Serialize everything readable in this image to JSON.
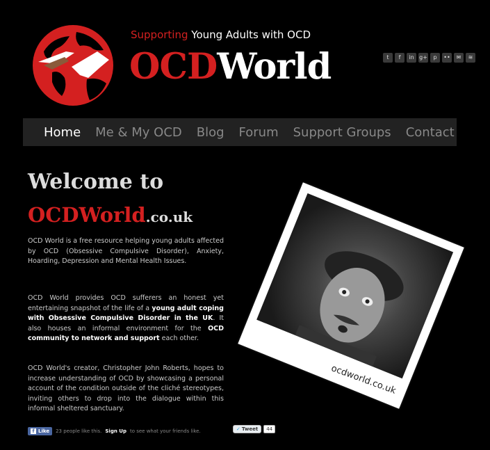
{
  "header": {
    "tagline_highlight": "Supporting",
    "tagline_rest": " Young Adults with OCD",
    "brand_red": "OCD",
    "brand_white": "World"
  },
  "social": [
    {
      "icon": "twitter-icon",
      "glyph": "t"
    },
    {
      "icon": "facebook-icon",
      "glyph": "f"
    },
    {
      "icon": "linkedin-icon",
      "glyph": "in"
    },
    {
      "icon": "googleplus-icon",
      "glyph": "g+"
    },
    {
      "icon": "pinterest-icon",
      "glyph": "p"
    },
    {
      "icon": "flickr-icon",
      "glyph": "••"
    },
    {
      "icon": "email-icon",
      "glyph": "✉"
    },
    {
      "icon": "rss-icon",
      "glyph": "≋"
    }
  ],
  "nav": {
    "items": [
      "Home",
      "Me & My OCD",
      "Blog",
      "Forum",
      "Support Groups",
      "Contact"
    ]
  },
  "main": {
    "welcome": "Welcome to",
    "site_name": "OCDWorld",
    "site_suffix": ".co.uk",
    "p1": "OCD World is a free resource helping young adults affected by OCD (Obsessive Compulsive Disorder), Anxiety, Hoarding, Depression and Mental Health Issues.",
    "p2_a": "OCD World provides OCD sufferers an honest yet entertaining snapshot of the life of a ",
    "p2_b": "young adult coping with Obsessive Compulsive Disorder in the UK",
    "p2_c": ". It also houses an informal environment for the ",
    "p2_d": "OCD community to network and support",
    "p2_e": " each other.",
    "p3": "OCD World's creator, Christopher John Roberts, hopes to increase understanding of OCD by showcasing a personal account of the condition outside of the cliché stereotypes, inviting others to drop into the dialogue within this informal sheltered sanctuary."
  },
  "photo": {
    "caption": "ocdworld.co.uk"
  },
  "footer": {
    "like_label": "Like",
    "like_text_a": "23 people like this.",
    "like_signup": "Sign Up",
    "like_text_b": "to see what your friends like.",
    "tweet_label": "Tweet",
    "tweet_count": "44"
  },
  "colors": {
    "accent": "#d42020",
    "background": "#000000",
    "nav_bg": "#222222"
  }
}
